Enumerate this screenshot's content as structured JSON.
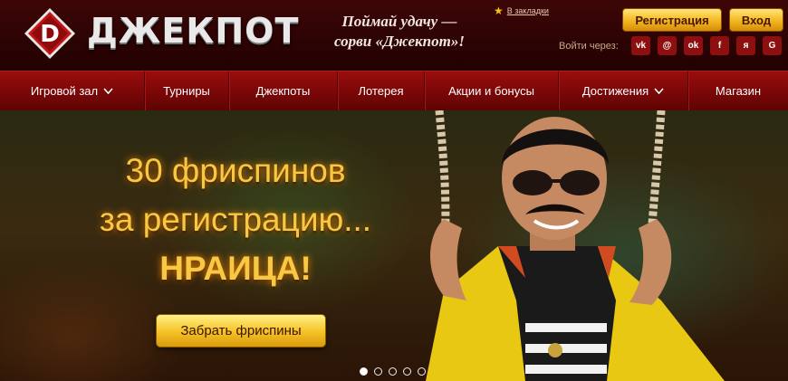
{
  "header": {
    "logo_text": "ДЖЕКПОТ",
    "slogan_line1": "Поймай удачу —",
    "slogan_line2": "сорви «Джекпот»!",
    "bookmark_label": "В закладки",
    "register_label": "Регистрация",
    "login_label": "Вход",
    "login_via_label": "Войти через:",
    "social": [
      {
        "label": "vk",
        "icon": "vk-icon"
      },
      {
        "label": "@",
        "icon": "mail-ru-icon"
      },
      {
        "label": "ok",
        "icon": "odnoklassniki-icon"
      },
      {
        "label": "f",
        "icon": "facebook-icon"
      },
      {
        "label": "я",
        "icon": "yandex-icon"
      },
      {
        "label": "G",
        "icon": "google-icon"
      }
    ]
  },
  "nav": {
    "items": [
      {
        "label": "Игровой зал",
        "dropdown": true
      },
      {
        "label": "Турниры",
        "dropdown": false
      },
      {
        "label": "Джекпоты",
        "dropdown": false
      },
      {
        "label": "Лотерея",
        "dropdown": false
      },
      {
        "label": "Акции и бонусы",
        "dropdown": false
      },
      {
        "label": "Достижения",
        "dropdown": true
      },
      {
        "label": "Магазин",
        "dropdown": false
      }
    ]
  },
  "hero": {
    "title_line1": "30 фриспинов",
    "title_line2": "за регистрацию...",
    "title_line3": "НРАИЦА!",
    "cta_label": "Забрать фриспины",
    "slides_count": 5,
    "active_slide": 1
  },
  "colors": {
    "brand_red": "#7a0707",
    "gold": "#f3b61f",
    "hero_text": "#f7c844"
  }
}
